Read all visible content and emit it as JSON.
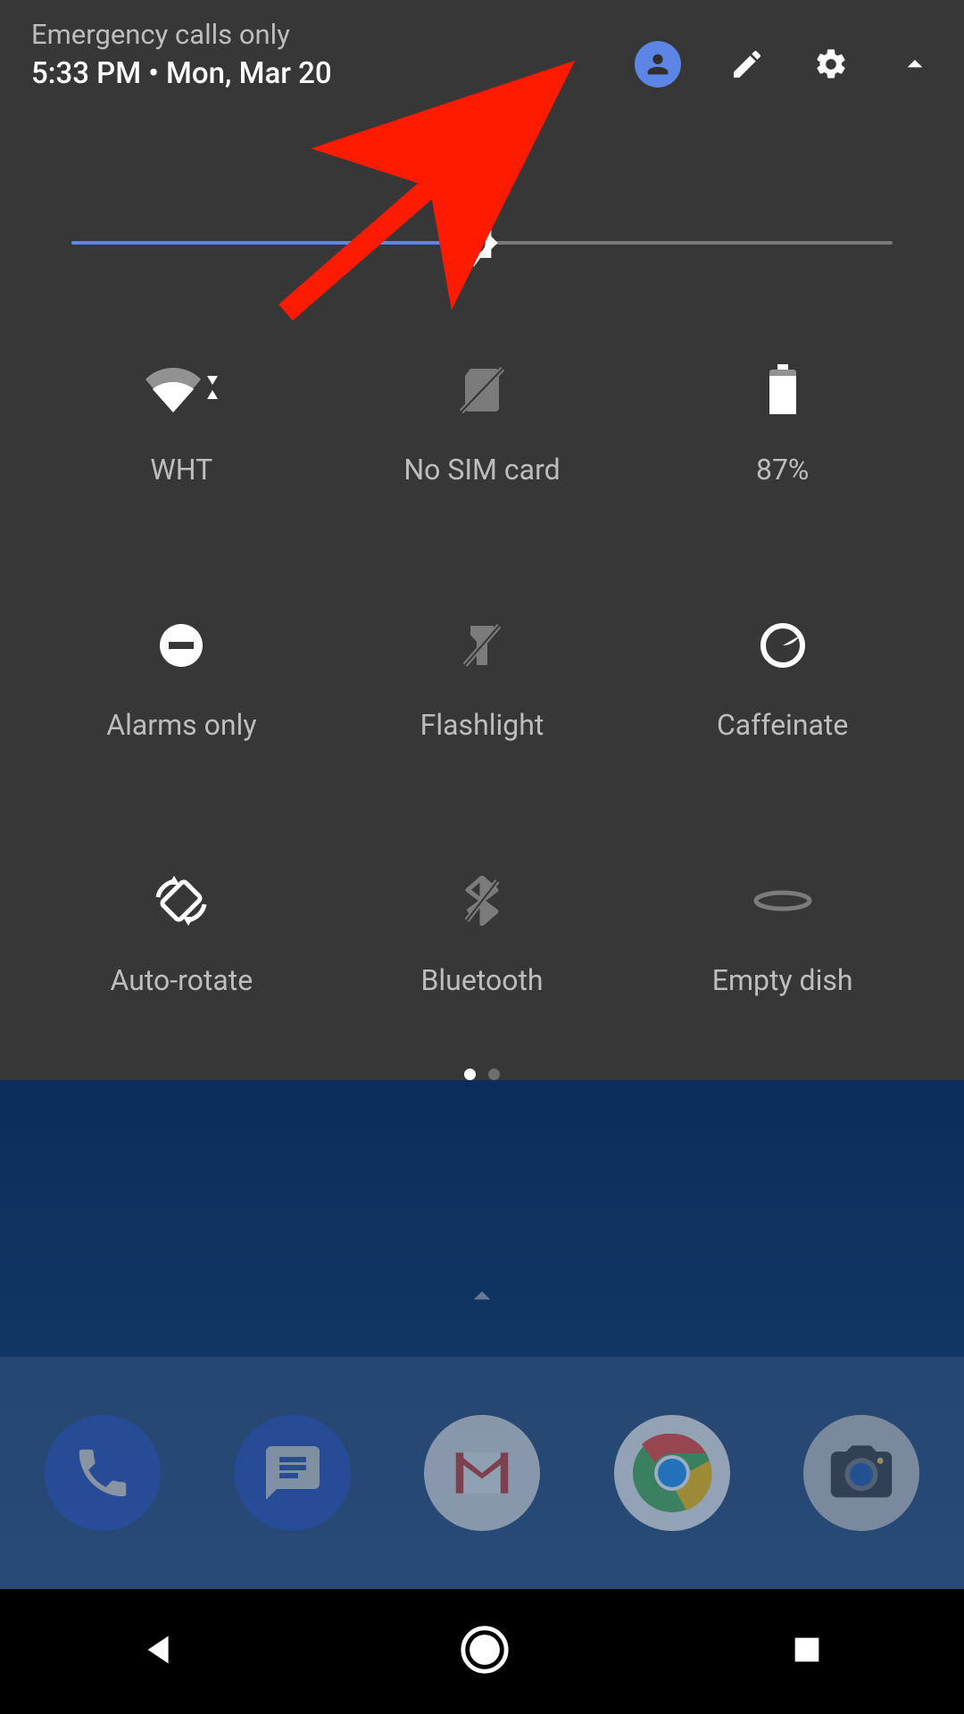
{
  "header": {
    "emergency": "Emergency calls only",
    "time": "5:33 PM",
    "sep": "  •  ",
    "date": "Mon, Mar 20"
  },
  "brightness": {
    "percent": 49
  },
  "tiles": [
    {
      "id": "wifi",
      "label": "WHT",
      "active": true
    },
    {
      "id": "sim",
      "label": "No SIM card",
      "active": false
    },
    {
      "id": "battery",
      "label": "87%",
      "active": true
    },
    {
      "id": "dnd",
      "label": "Alarms only",
      "active": true
    },
    {
      "id": "flashlight",
      "label": "Flashlight",
      "active": false
    },
    {
      "id": "caffeinate",
      "label": "Caffeinate",
      "active": true
    },
    {
      "id": "rotate",
      "label": "Auto-rotate",
      "active": true
    },
    {
      "id": "bluetooth",
      "label": "Bluetooth",
      "active": false
    },
    {
      "id": "dish",
      "label": "Empty dish",
      "active": false
    }
  ],
  "pager": {
    "pages": 2,
    "current": 0
  },
  "dock_apps": [
    {
      "id": "phone"
    },
    {
      "id": "messages"
    },
    {
      "id": "gmail"
    },
    {
      "id": "chrome"
    },
    {
      "id": "camera"
    }
  ],
  "annotation": {
    "type": "arrow",
    "points_to": "edit-icon"
  }
}
